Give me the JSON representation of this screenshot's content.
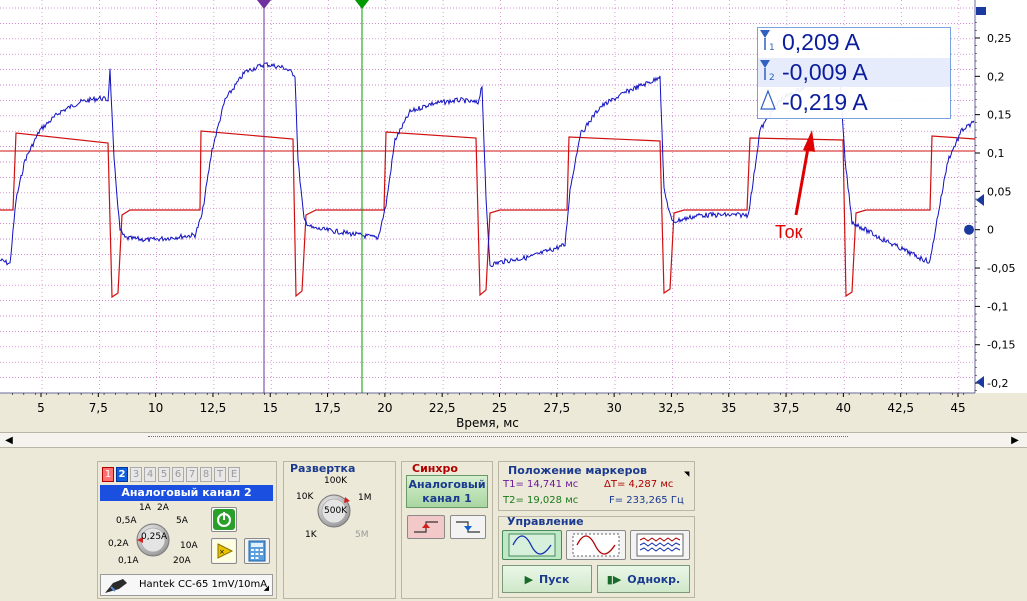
{
  "scope": {
    "x_axis_title": "Время, мс",
    "x_ticks": [
      "5",
      "7,5",
      "10",
      "12,5",
      "15",
      "17,5",
      "20",
      "22,5",
      "25",
      "27,5",
      "30",
      "32,5",
      "35",
      "37,5",
      "40",
      "42,5",
      "45"
    ],
    "y_ticks": [
      "0,25",
      "0,2",
      "0,15",
      "0,1",
      "0,05",
      "0",
      "-0,05",
      "-0,1",
      "-0,15",
      "-0,2"
    ],
    "annotation_label": "Ток",
    "colors": {
      "grid_dot": "#c060c0",
      "trace_current": "#1010c0",
      "trace_red": "#d01010",
      "marker1": "#7030a0",
      "marker2": "#009900",
      "annotation": "#e00000"
    }
  },
  "measurements": {
    "t1_value": "0,209 A",
    "t2_value": "-0,009 A",
    "delta_value": "-0,219 A"
  },
  "panel": {
    "channel_tabs": [
      "1",
      "2",
      "3",
      "4",
      "5",
      "6",
      "7",
      "8",
      "T",
      "E"
    ],
    "channel_title": "Аналоговый канал 2",
    "range_labels": [
      "1A",
      "2A",
      "0,5A",
      "5A",
      "0,2A",
      "0,25A",
      "10A",
      "0,1A",
      "20A"
    ],
    "probe_name": "Hantek CC-65 1mV/10mA",
    "timebase_title": "Развертка",
    "timebase_labels": [
      "100K",
      "10K",
      "1M",
      "500K",
      "1K",
      "5M"
    ],
    "sync_title": "Синхро",
    "sync_source": "Аналоговый канал 1",
    "markers_title": "Положение маркеров",
    "t1": "T1= 14,741 мс",
    "t2": "T2= 19,028 мс",
    "dt": "ΔT= 4,287 мс",
    "freq": "F= 233,265 Гц",
    "control_title": "Управление",
    "run_label": "Пуск",
    "single_label": "Однокр."
  }
}
